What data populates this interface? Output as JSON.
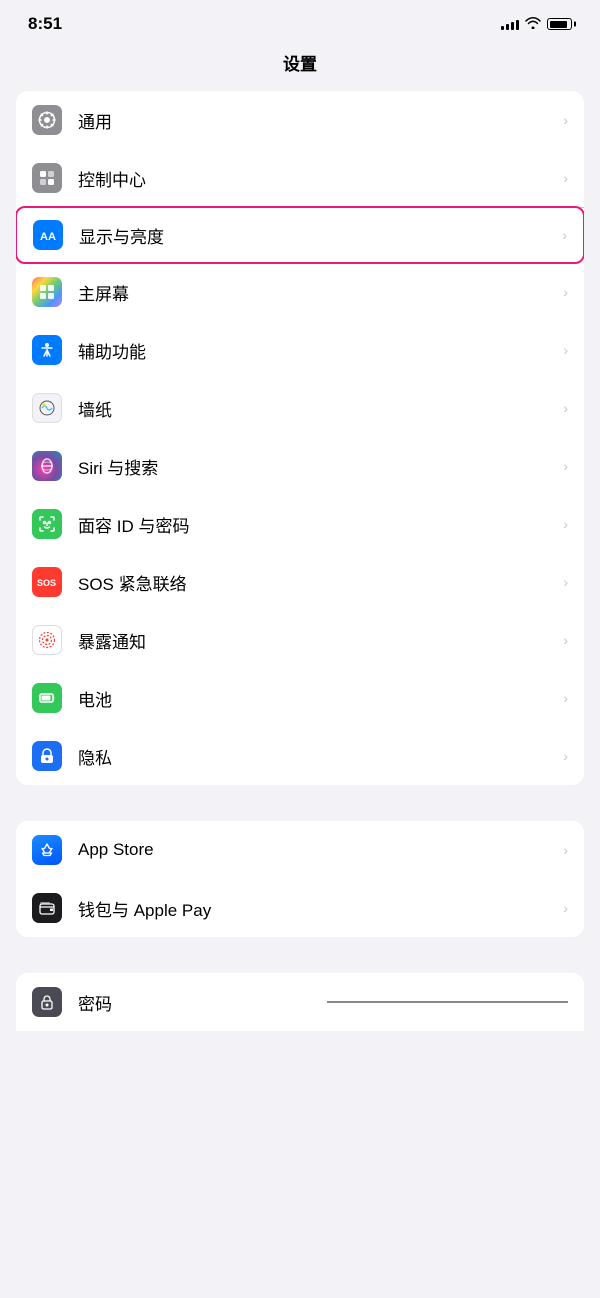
{
  "statusBar": {
    "time": "8:51",
    "signal": "signal",
    "wifi": "wifi",
    "battery": "battery"
  },
  "pageTitle": "设置",
  "sections": [
    {
      "id": "section1",
      "items": [
        {
          "id": "general",
          "label": "通用",
          "iconBg": "icon-gray",
          "iconType": "gear",
          "highlighted": false
        },
        {
          "id": "control-center",
          "label": "控制中心",
          "iconBg": "icon-gray2",
          "iconType": "toggle",
          "highlighted": false
        },
        {
          "id": "display",
          "label": "显示与亮度",
          "iconBg": "icon-blue",
          "iconType": "aa",
          "highlighted": true
        },
        {
          "id": "home-screen",
          "label": "主屏幕",
          "iconBg": "icon-multicolor",
          "iconType": "home",
          "highlighted": false
        },
        {
          "id": "accessibility",
          "label": "辅助功能",
          "iconBg": "icon-blue2",
          "iconType": "accessibility",
          "highlighted": false
        },
        {
          "id": "wallpaper",
          "label": "墙纸",
          "iconBg": "icon-flower",
          "iconType": "flower",
          "highlighted": false
        },
        {
          "id": "siri",
          "label": "Siri 与搜索",
          "iconBg": "icon-siri",
          "iconType": "siri",
          "highlighted": false
        },
        {
          "id": "faceid",
          "label": "面容 ID 与密码",
          "iconBg": "icon-green",
          "iconType": "faceid",
          "highlighted": false
        },
        {
          "id": "sos",
          "label": "SOS 紧急联络",
          "iconBg": "icon-red",
          "iconType": "sos",
          "highlighted": false
        },
        {
          "id": "exposure",
          "label": "暴露通知",
          "iconBg": "icon-exposure",
          "iconType": "exposure",
          "highlighted": false
        },
        {
          "id": "battery",
          "label": "电池",
          "iconBg": "icon-battery",
          "iconType": "battery",
          "highlighted": false
        },
        {
          "id": "privacy",
          "label": "隐私",
          "iconBg": "icon-privacy",
          "iconType": "hand",
          "highlighted": false
        }
      ]
    },
    {
      "id": "section2",
      "items": [
        {
          "id": "appstore",
          "label": "App Store",
          "iconBg": "icon-appstore",
          "iconType": "appstore",
          "highlighted": false
        },
        {
          "id": "wallet",
          "label": "钱包与 Apple Pay",
          "iconBg": "icon-wallet",
          "iconType": "wallet",
          "highlighted": false
        }
      ]
    }
  ],
  "partialItem": {
    "id": "password",
    "label": "密码",
    "iconBg": "icon-password",
    "iconType": "password"
  }
}
